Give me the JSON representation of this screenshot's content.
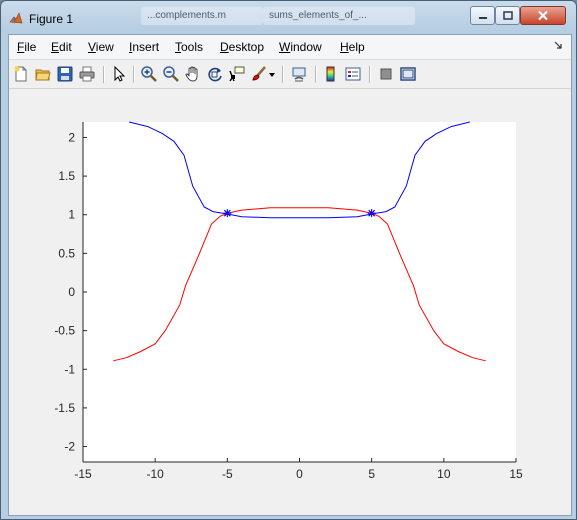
{
  "window": {
    "title": "Figure 1",
    "background_tabs": [
      "...complements.m",
      "sums_elements_of_..."
    ]
  },
  "menu": {
    "items": [
      {
        "label": "File",
        "ul": "F",
        "rest": "ile"
      },
      {
        "label": "Edit",
        "ul": "E",
        "rest": "dit"
      },
      {
        "label": "View",
        "ul": "V",
        "rest": "iew"
      },
      {
        "label": "Insert",
        "ul": "I",
        "rest": "nsert"
      },
      {
        "label": "Tools",
        "ul": "T",
        "rest": "ools"
      },
      {
        "label": "Desktop",
        "ul": "D",
        "rest": "esktop"
      },
      {
        "label": "Window",
        "ul": "W",
        "rest": "indow"
      },
      {
        "label": "Help",
        "ul": "H",
        "rest": "elp"
      }
    ]
  },
  "toolbar": {
    "icons": [
      "new-figure-icon",
      "open-file-icon",
      "save-icon",
      "print-icon",
      "edit-plot-arrow-icon",
      "zoom-in-icon",
      "zoom-out-icon",
      "pan-hand-icon",
      "rotate-3d-icon",
      "data-cursor-icon",
      "brush-icon",
      "brush-dropdown-icon",
      "link-plot-icon",
      "insert-colorbar-icon",
      "insert-legend-icon",
      "hide-plot-tools-icon",
      "show-plot-tools-icon"
    ]
  },
  "colors": {
    "blue_series": "#0000ff",
    "red_series": "#ff0000",
    "axes_bg": "#ffffff",
    "figure_bg": "#f0f0f0"
  },
  "chart_data": {
    "type": "line",
    "title": "",
    "xlabel": "",
    "ylabel": "",
    "xlim": [
      -15,
      15
    ],
    "ylim": [
      -2.2,
      2.2
    ],
    "xticks": [
      -15,
      -10,
      -5,
      0,
      5,
      10,
      15
    ],
    "yticks": [
      2,
      1.5,
      1,
      0.5,
      0,
      -0.5,
      -1,
      -1.5,
      -2
    ],
    "grid": false,
    "series": [
      {
        "color": "blue",
        "x": [
          -11.8,
          -10.5,
          -9.5,
          -8.7,
          -8,
          -7.4,
          -6.6,
          -6,
          -5,
          -4,
          -2,
          0,
          2,
          4,
          5,
          6,
          6.6,
          7.4,
          8,
          8.7,
          9.5,
          10.5,
          11.8
        ],
        "y": [
          2.2,
          2.14,
          2.05,
          1.95,
          1.77,
          1.37,
          1.1,
          1.04,
          1.01,
          0.975,
          0.96,
          0.96,
          0.96,
          0.975,
          1.01,
          1.04,
          1.1,
          1.37,
          1.77,
          1.95,
          2.05,
          2.14,
          2.2
        ]
      },
      {
        "color": "red",
        "x": [
          -12.9,
          -12,
          -11,
          -10,
          -9.3,
          -8.3,
          -7.9,
          -7,
          -6.1,
          -5.5,
          -5,
          -4,
          -2,
          0,
          2,
          4,
          5,
          5.5,
          6.1,
          7,
          7.9,
          8.3,
          9.3,
          10,
          11,
          12,
          12.9
        ],
        "y": [
          -0.89,
          -0.85,
          -0.77,
          -0.67,
          -0.5,
          -0.17,
          0.08,
          0.47,
          0.88,
          0.98,
          1.02,
          1.06,
          1.09,
          1.09,
          1.09,
          1.06,
          1.02,
          0.98,
          0.88,
          0.47,
          0.08,
          -0.17,
          -0.5,
          -0.67,
          -0.77,
          -0.85,
          -0.89
        ]
      }
    ],
    "markers": [
      {
        "x": -5,
        "y": 1.02,
        "symbol": "*",
        "color": "blue"
      },
      {
        "x": 5,
        "y": 1.02,
        "symbol": "*",
        "color": "blue"
      }
    ]
  }
}
